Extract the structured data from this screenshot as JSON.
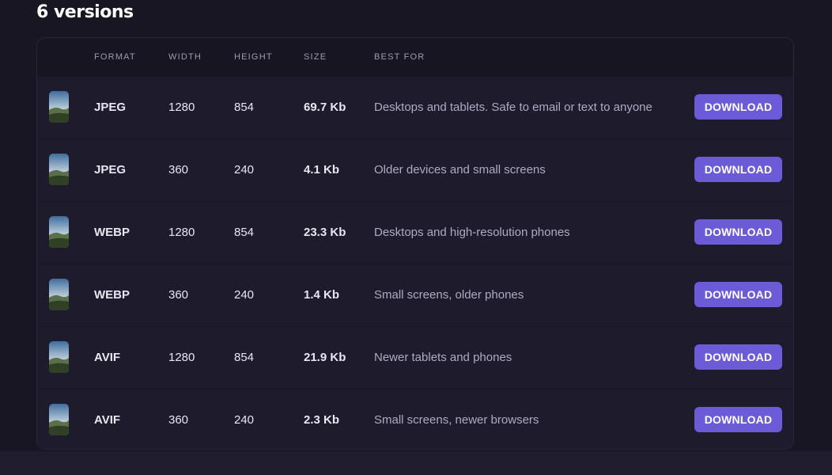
{
  "heading": "6 versions",
  "table": {
    "columns": {
      "format": "FORMAT",
      "width": "WIDTH",
      "height": "HEIGHT",
      "size": "SIZE",
      "best_for": "BEST FOR"
    },
    "rows": [
      {
        "format": "JPEG",
        "width": "1280",
        "height": "854",
        "size": "69.7 Kb",
        "best_for": "Desktops and tablets. Safe to email or text to anyone",
        "action": "DOWNLOAD"
      },
      {
        "format": "JPEG",
        "width": "360",
        "height": "240",
        "size": "4.1 Kb",
        "best_for": "Older devices and small screens",
        "action": "DOWNLOAD"
      },
      {
        "format": "WEBP",
        "width": "1280",
        "height": "854",
        "size": "23.3 Kb",
        "best_for": "Desktops and high-resolution phones",
        "action": "DOWNLOAD"
      },
      {
        "format": "WEBP",
        "width": "360",
        "height": "240",
        "size": "1.4 Kb",
        "best_for": "Small screens, older phones",
        "action": "DOWNLOAD"
      },
      {
        "format": "AVIF",
        "width": "1280",
        "height": "854",
        "size": "21.9 Kb",
        "best_for": "Newer tablets and phones",
        "action": "DOWNLOAD"
      },
      {
        "format": "AVIF",
        "width": "360",
        "height": "240",
        "size": "2.3 Kb",
        "best_for": "Small screens, newer browsers",
        "action": "DOWNLOAD"
      }
    ]
  },
  "colors": {
    "background": "#181622",
    "card": "#1c1a29",
    "accent": "#6b5bd6"
  },
  "icons": {
    "thumbnail": "landscape-thumbnail-icon"
  }
}
